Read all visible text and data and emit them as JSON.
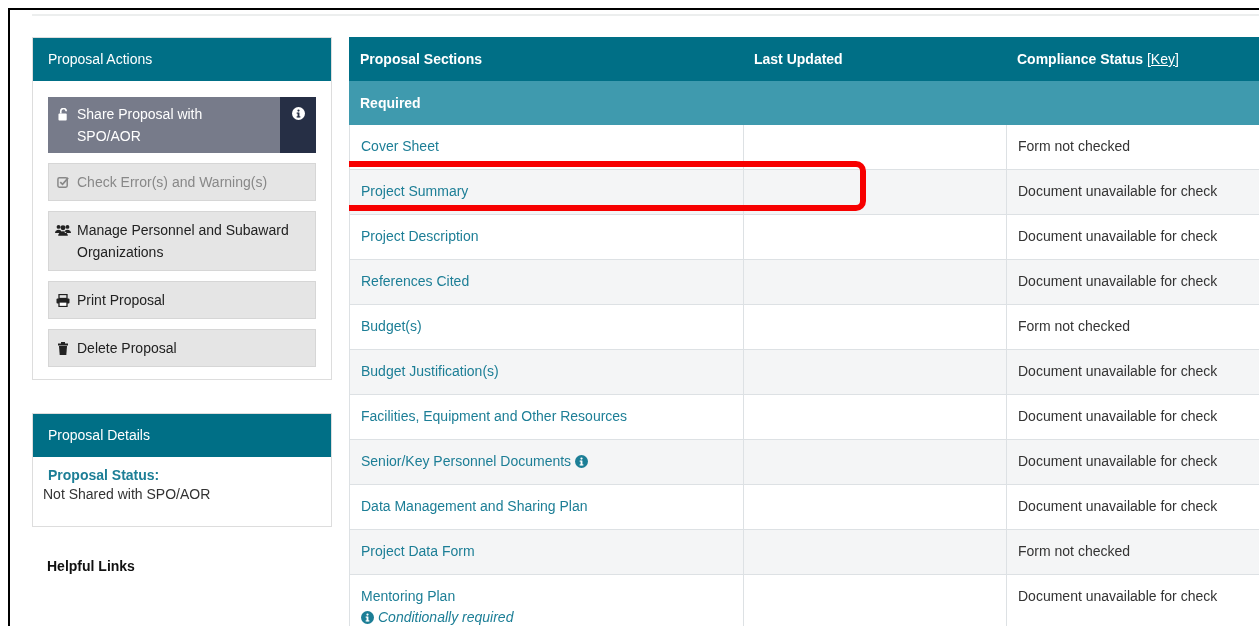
{
  "actions_panel": {
    "title": "Proposal Actions",
    "buttons": [
      {
        "label": "Share Proposal with SPO/AOR",
        "kind": "share",
        "disabled": false
      },
      {
        "label": "Check Error(s) and Warning(s)",
        "kind": "check",
        "disabled": true
      },
      {
        "label": "Manage Personnel and Subaward Organizations",
        "kind": "personnel",
        "disabled": false
      },
      {
        "label": "Print Proposal",
        "kind": "print",
        "disabled": false
      },
      {
        "label": "Delete Proposal",
        "kind": "delete",
        "disabled": false
      }
    ]
  },
  "details_panel": {
    "title": "Proposal Details",
    "status_label": "Proposal Status:",
    "status_value": "Not Shared with SPO/AOR"
  },
  "helpful_links": {
    "title": "Helpful Links"
  },
  "table": {
    "columns": [
      "Proposal Sections",
      "Last Updated",
      "Compliance Status"
    ],
    "key_link": "[Key]",
    "group": "Required",
    "rows": [
      {
        "section": "Cover Sheet",
        "status": "Form not checked",
        "highlighted": false
      },
      {
        "section": "Project Summary",
        "status": "Document unavailable for check",
        "highlighted": true
      },
      {
        "section": "Project Description",
        "status": "Document unavailable for check",
        "highlighted": false
      },
      {
        "section": "References Cited",
        "status": "Document unavailable for check",
        "highlighted": false
      },
      {
        "section": "Budget(s)",
        "status": "Form not checked",
        "highlighted": false
      },
      {
        "section": "Budget Justification(s)",
        "status": "Document unavailable for check",
        "highlighted": false
      },
      {
        "section": "Facilities, Equipment and Other Resources",
        "status": "Document unavailable for check",
        "highlighted": false
      },
      {
        "section": "Senior/Key Personnel Documents",
        "info": true,
        "status": "Document unavailable for check",
        "highlighted": false
      },
      {
        "section": "Data Management and Sharing Plan",
        "status": "Document unavailable for check",
        "highlighted": false
      },
      {
        "section": "Project Data Form",
        "status": "Form not checked",
        "highlighted": false
      },
      {
        "section": "Mentoring Plan",
        "note": "Conditionally required",
        "status": "Document unavailable for check",
        "highlighted": false
      }
    ]
  }
}
